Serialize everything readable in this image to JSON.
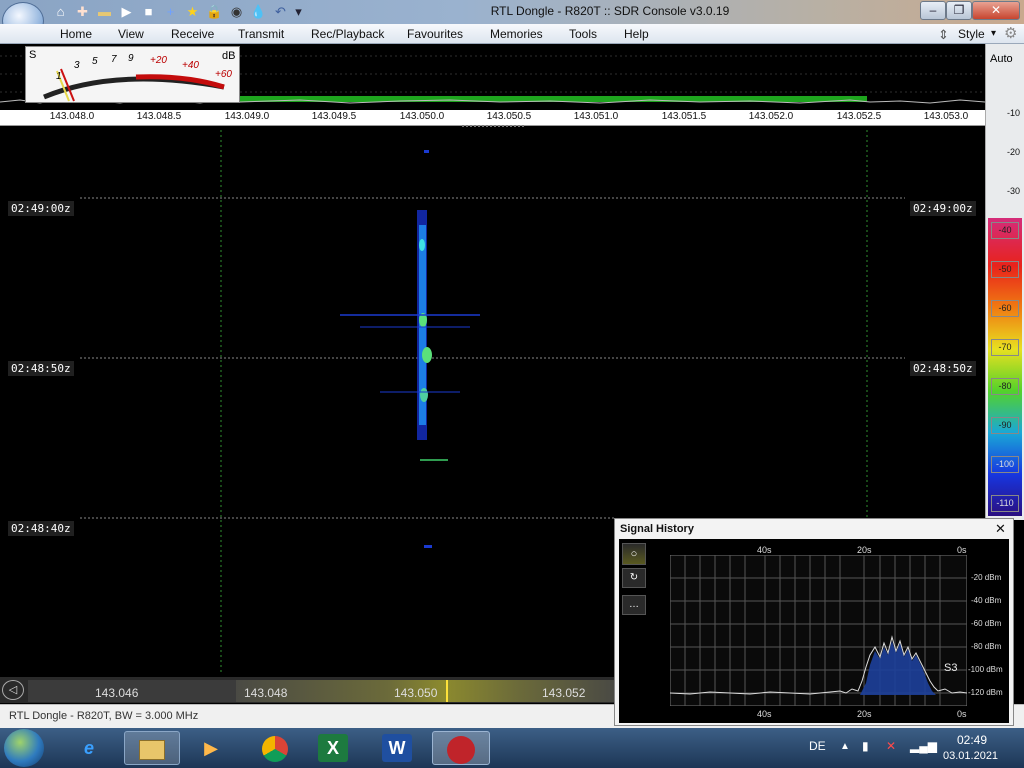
{
  "window": {
    "title": "RTL Dongle - R820T :: SDR Console v3.0.19",
    "min_glyph": "–",
    "max_glyph": "❐",
    "close_glyph": "✕"
  },
  "quick_access": {
    "home_icon": "⌂",
    "help_icon": "✚",
    "folder_icon": "▬",
    "play_icon": "▶",
    "stop_icon": "■",
    "info_icon": "+",
    "star_icon": "★",
    "lock_icon": "🔒",
    "camera_icon": "◉",
    "drop_icon": "💧",
    "undo_icon": "↶",
    "more_icon": "▾"
  },
  "menu": {
    "items": [
      "Home",
      "View",
      "Receive",
      "Transmit",
      "Rec/Playback",
      "Favourites",
      "Memories",
      "Tools",
      "Help"
    ],
    "style_label": "Style",
    "style_arrow": "▾",
    "updown_glyph": "⇕",
    "gear_glyph": "⚙"
  },
  "smeter": {
    "s_label": "S",
    "db_label": "dB",
    "scale": [
      "1",
      "3",
      "5",
      "7",
      "9",
      "+20",
      "+40",
      "+60"
    ]
  },
  "freq_axis": [
    "143.048.0",
    "143.048.5",
    "143.049.0",
    "143.049.5",
    "143.050.0",
    "143.050.5",
    "143.051.0",
    "143.051.5",
    "143.052.0",
    "143.052.5",
    "143.053.0"
  ],
  "db_scale": {
    "auto": "Auto",
    "plain": [
      "-10",
      "-20",
      "-30"
    ],
    "chips": [
      "-40",
      "-50",
      "-60",
      "-70",
      "-80",
      "-90",
      "-100",
      "-110"
    ],
    "chip_colors": [
      "#d42c7a",
      "#e8231c",
      "#f07a12",
      "#e8e020",
      "#54d22a",
      "#1aa8d6",
      "#1736e0",
      "#3a1aa8"
    ]
  },
  "waterfall": {
    "times": [
      "02:49:00z",
      "02:48:50z",
      "02:48:40z"
    ]
  },
  "bottom_bar": {
    "freqs": [
      "143.046",
      "143.048",
      "143.050",
      "143.052"
    ],
    "rewind_glyph": "◁"
  },
  "status": "RTL Dongle - R820T, BW = 3.000 MHz",
  "signal_history": {
    "title": "Signal History",
    "close_glyph": "✕",
    "btn_glyphs": [
      "○",
      "↻",
      "…"
    ],
    "time_labels": [
      "40s",
      "20s",
      "0s"
    ],
    "db_labels": [
      "-20 dBm",
      "-40 dBm",
      "-60 dBm",
      "-80 dBm",
      "-100 dBm",
      "-120 dBm"
    ],
    "s_label": "S3"
  },
  "taskbar": {
    "lang": "DE",
    "time": "02:49",
    "date": "03.01.2021",
    "start_icon": "start-orb-icon"
  }
}
